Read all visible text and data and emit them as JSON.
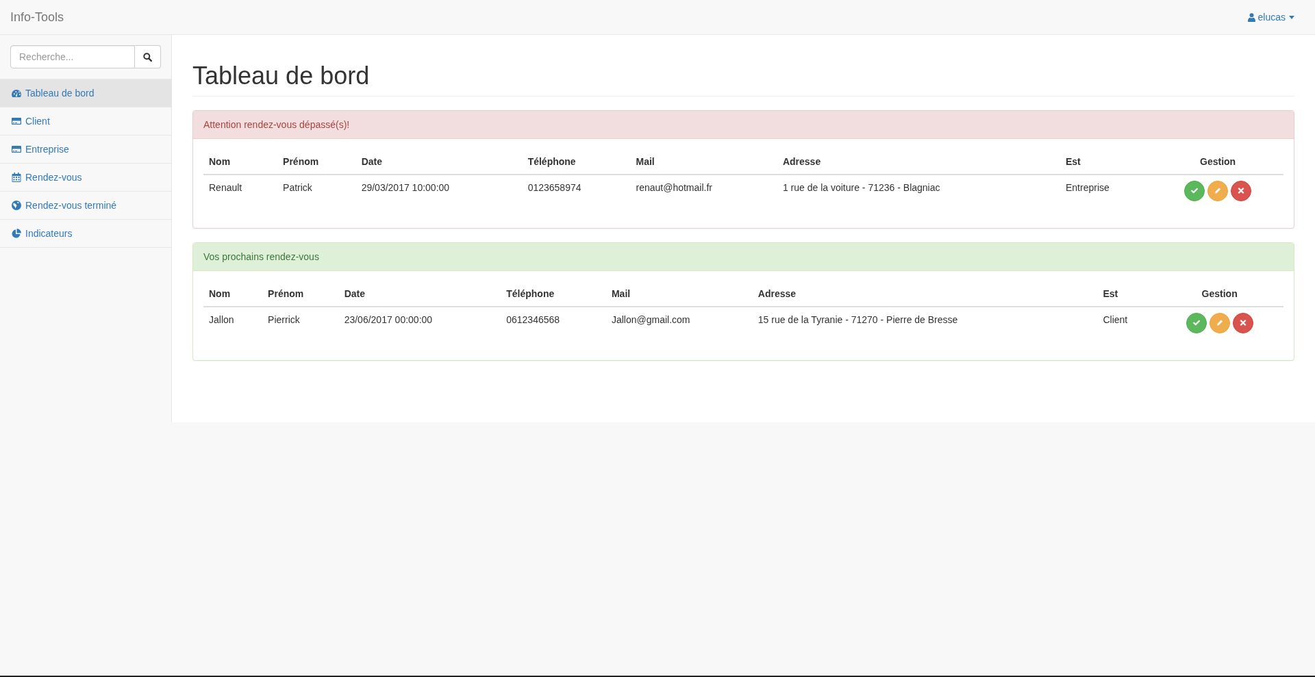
{
  "navbar": {
    "brand": "Info-Tools",
    "user": "elucas"
  },
  "sidebar": {
    "search": {
      "placeholder": "Recherche..."
    },
    "items": [
      {
        "label": "Tableau de bord",
        "kind": "dashboard",
        "selected": true
      },
      {
        "label": "Client",
        "kind": "card",
        "selected": false
      },
      {
        "label": "Entreprise",
        "kind": "card",
        "selected": false
      },
      {
        "label": "Rendez-vous",
        "kind": "calendar",
        "selected": false
      },
      {
        "label": "Rendez-vous terminé",
        "kind": "globe",
        "selected": false
      },
      {
        "label": "Indicateurs",
        "kind": "chart",
        "selected": false
      }
    ]
  },
  "page_title": "Tableau de bord",
  "panels": [
    {
      "kind": "danger",
      "title": "Attention rendez-vous dépassé(s)!",
      "table": {
        "columns": [
          "Nom",
          "Prénom",
          "Date",
          "Téléphone",
          "Mail",
          "Adresse",
          "Est",
          "Gestion"
        ],
        "rows": [
          {
            "cells": [
              "Renault",
              "Patrick",
              "29/03/2017 10:00:00",
              "0123658974",
              "renaut@hotmail.fr",
              "1 rue de la voiture - 71236 - Blagniac",
              "Entreprise"
            ],
            "actions": [
              {
                "kind": "confirm"
              },
              {
                "kind": "edit"
              },
              {
                "kind": "delete"
              }
            ]
          }
        ]
      }
    },
    {
      "kind": "success",
      "title": "Vos prochains rendez-vous",
      "table": {
        "columns": [
          "Nom",
          "Prénom",
          "Date",
          "Téléphone",
          "Mail",
          "Adresse",
          "Est",
          "Gestion"
        ],
        "rows": [
          {
            "cells": [
              "Jallon",
              "Pierrick",
              "23/06/2017 00:00:00",
              "0612346568",
              "Jallon@gmail.com",
              "15 rue de la Tyranie - 71270 - Pierre de Bresse",
              "Client"
            ],
            "actions": [
              {
                "kind": "confirm"
              },
              {
                "kind": "edit"
              },
              {
                "kind": "delete"
              }
            ]
          }
        ]
      }
    }
  ]
}
